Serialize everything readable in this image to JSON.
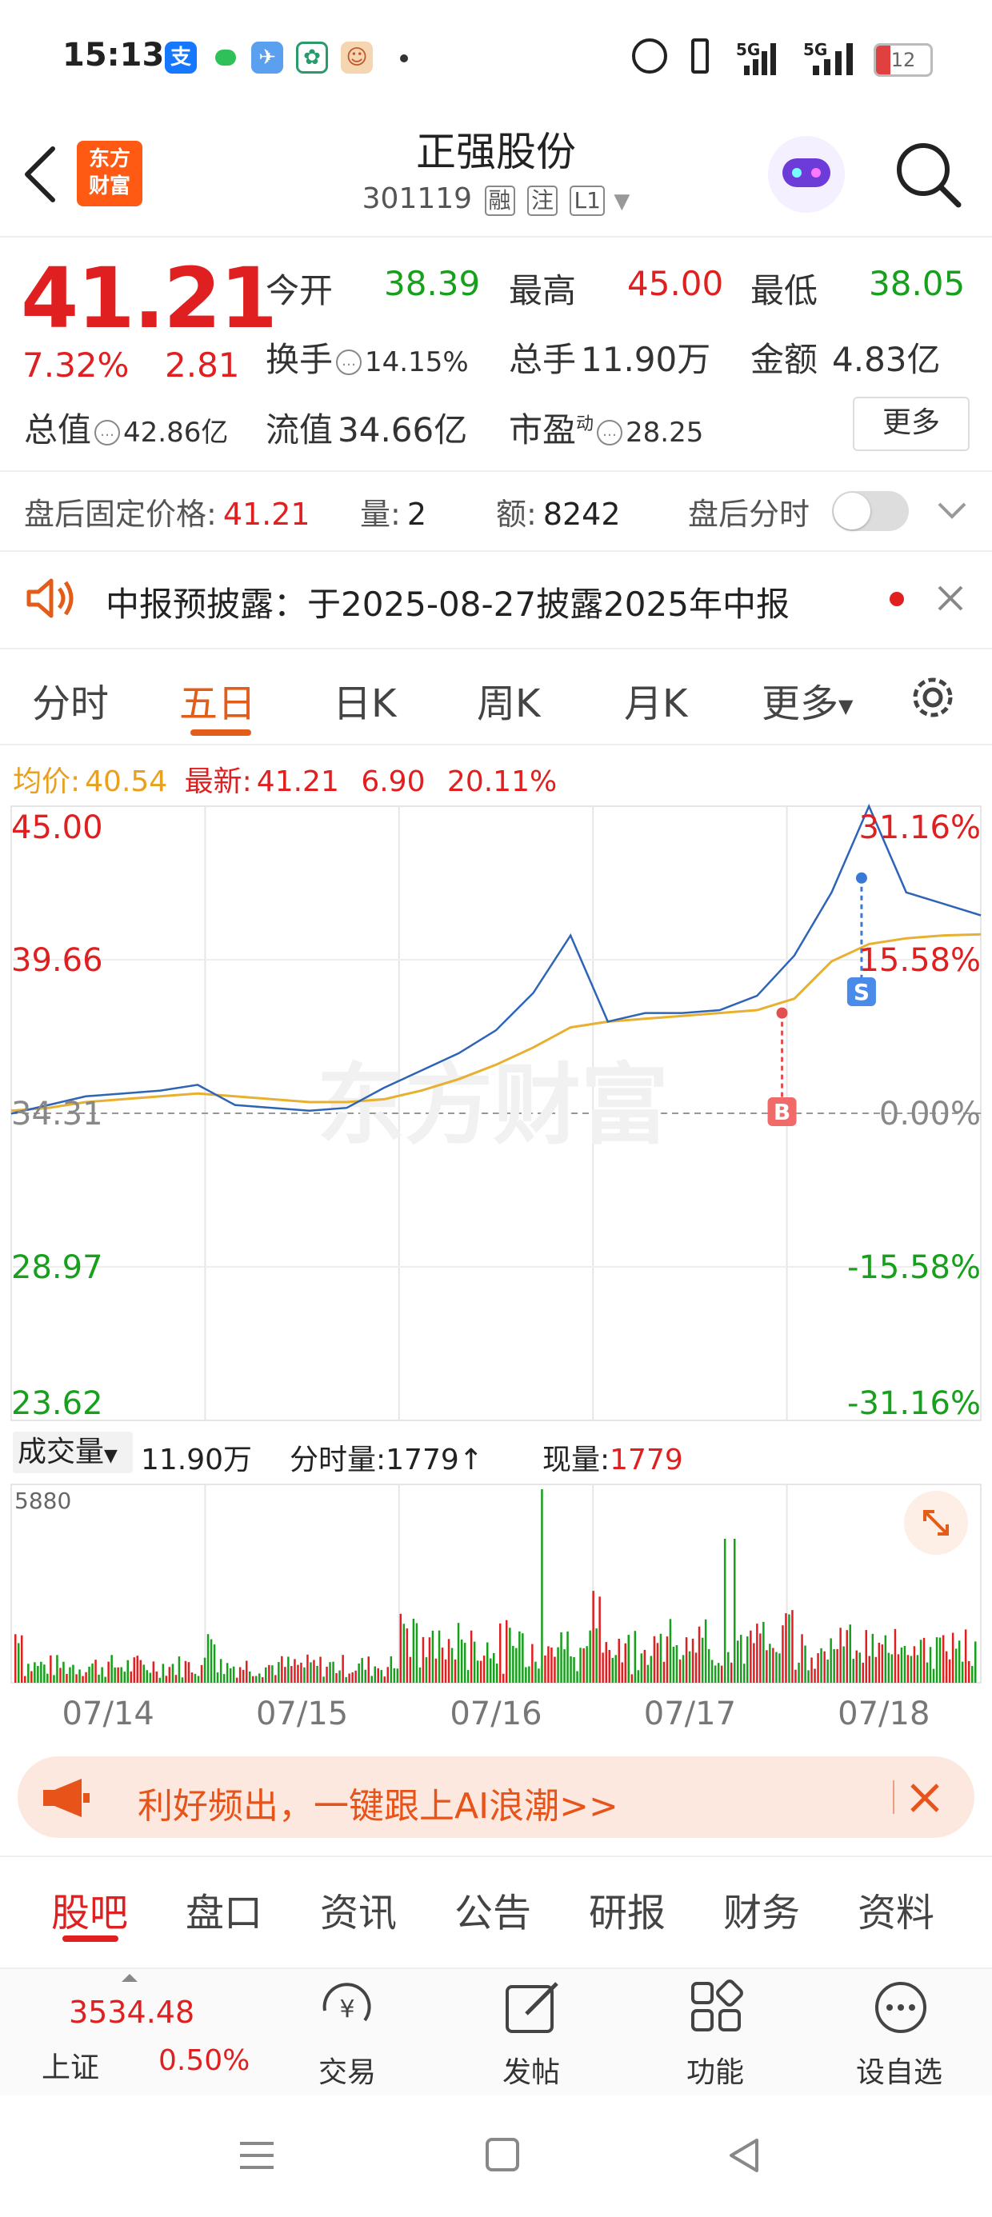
{
  "status_bar": {
    "time": "15:13",
    "net1": "5G",
    "net2": "5G",
    "battery": "12",
    "app_icons": [
      "alipay-icon",
      "chat-icon",
      "compass-icon",
      "pinwheel-icon",
      "mascot-icon"
    ]
  },
  "header": {
    "logo_line1": "东方",
    "logo_line2": "财富",
    "title": "正强股份",
    "code": "301119",
    "tags": [
      "融",
      "注",
      "L1"
    ]
  },
  "quote": {
    "price": "41.21",
    "change_pct": "7.32%",
    "change_amt": "2.81",
    "open_label": "今开",
    "open": "38.39",
    "high_label": "最高",
    "high": "45.00",
    "low_label": "最低",
    "low": "38.05",
    "turnover_label": "换手",
    "turnover": "14.15%",
    "volume_label": "总手",
    "volume": "11.90万",
    "amount_label": "金额",
    "amount": "4.83亿",
    "mktcap_label": "总值",
    "mktcap": "42.86亿",
    "float_label": "流值",
    "float": "34.66亿",
    "pe_label": "市盈",
    "pe_sup": "动",
    "pe": "28.25",
    "more": "更多"
  },
  "after_hours": {
    "price_label": "盘后固定价格:",
    "price": "41.21",
    "qty_label": "量:",
    "qty": "2",
    "amt_label": "额:",
    "amt": "8242",
    "toggle_label": "盘后分时"
  },
  "notice": {
    "text": "中报预披露：于2025-08-27披露2025年中报"
  },
  "chart_tabs": [
    "分时",
    "五日",
    "日K",
    "周K",
    "月K",
    "更多"
  ],
  "chart_header": {
    "avg_label": "均价:",
    "avg": "40.54",
    "latest_label": "最新:",
    "latest": "41.21",
    "chg": "6.90",
    "chg_pct": "20.11%"
  },
  "chart_data": {
    "type": "line",
    "x": [
      "07/14",
      "07/15",
      "07/16",
      "07/17",
      "07/18"
    ],
    "y_ticks": [
      "45.00",
      "39.66",
      "34.31",
      "28.97",
      "23.62"
    ],
    "pct_ticks": [
      "31.16%",
      "15.58%",
      "0.00%",
      "-15.58%",
      "-31.16%"
    ],
    "ylim": [
      23.62,
      45.0
    ],
    "base": 34.31,
    "series": [
      {
        "name": "price",
        "values": [
          34.3,
          34.6,
          34.9,
          35.0,
          35.1,
          35.3,
          34.6,
          34.5,
          34.4,
          34.5,
          35.2,
          35.8,
          36.4,
          37.2,
          38.5,
          40.5,
          37.5,
          37.8,
          37.8,
          37.9,
          38.4,
          39.8,
          42.0,
          45.0,
          42.0,
          41.6,
          41.2
        ]
      },
      {
        "name": "avg",
        "values": [
          34.4,
          34.5,
          34.7,
          34.8,
          34.9,
          35.0,
          34.9,
          34.8,
          34.7,
          34.7,
          34.8,
          35.1,
          35.5,
          36.0,
          36.6,
          37.3,
          37.5,
          37.6,
          37.7,
          37.8,
          37.9,
          38.3,
          39.6,
          40.2,
          40.4,
          40.5,
          40.54
        ]
      }
    ],
    "markers": [
      {
        "label": "B",
        "value": 37.8
      },
      {
        "label": "S",
        "value": 42.5
      }
    ]
  },
  "volume": {
    "label": "成交量",
    "total": "11.90万",
    "tick_label": "分时量:",
    "tick": "1779",
    "now_label": "现量:",
    "now": "1779",
    "max": "5880"
  },
  "promo": {
    "text": "利好频出，一键跟上AI浪潮>>"
  },
  "bottom_tabs": [
    "股吧",
    "盘口",
    "资讯",
    "公告",
    "研报",
    "财务",
    "资料"
  ],
  "toolbar": {
    "index_value": "3534.48",
    "index_name": "上证",
    "index_pct": "0.50%",
    "items": [
      "交易",
      "发帖",
      "功能",
      "设自选"
    ]
  },
  "colors": {
    "up": "#e02020",
    "down": "#16a01b",
    "accent": "#e35d1a",
    "avg_line": "#e8b030",
    "price_line": "#2e64b6"
  }
}
